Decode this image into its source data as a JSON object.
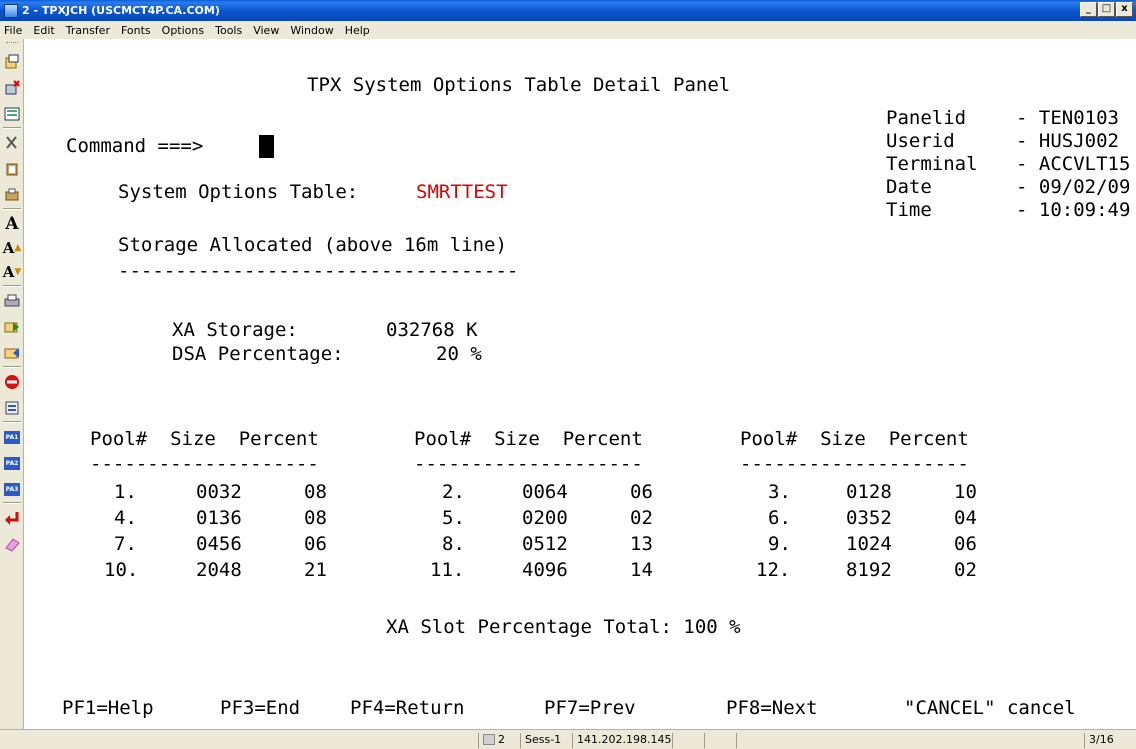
{
  "window": {
    "title": "2 - TPXJCH (USCMCT4P.CA.COM)",
    "min": "_",
    "max": "□",
    "close": "x"
  },
  "menu": [
    "File",
    "Edit",
    "Transfer",
    "Fonts",
    "Options",
    "Tools",
    "View",
    "Window",
    "Help"
  ],
  "toolbar": {
    "icons": [
      "copy-icon",
      "paste-icon",
      "select-icon",
      "cut-icon",
      "clipboard-icon",
      "print-screen-icon",
      "font-a-icon",
      "font-increase-icon",
      "font-decrease-icon",
      "print-icon",
      "send-icon",
      "receive-icon",
      "stop-icon",
      "properties-icon",
      "pa1-icon",
      "pa2-icon",
      "pa3-icon",
      "enter-icon",
      "eraser-icon"
    ],
    "labels": {
      "font_a": "A",
      "font_up": "A",
      "font_down": "A",
      "pa1": "PA1",
      "pa2": "PA2",
      "pa3": "PA3"
    }
  },
  "screen": {
    "header": "TPX System Options Table Detail Panel",
    "command_label": "Command ===>",
    "info": [
      {
        "label": "Panelid",
        "value": "- TEN0103"
      },
      {
        "label": "Userid",
        "value": "- HUSJ002"
      },
      {
        "label": "Terminal",
        "value": "- ACCVLT15"
      },
      {
        "label": "Date",
        "value": "- 09/02/09"
      },
      {
        "label": "Time",
        "value": "- 10:09:49"
      }
    ],
    "table_label": "System Options Table:",
    "table_name": "SMRTTEST",
    "storage_label": "Storage Allocated (above 16m line)",
    "storage_rule": "-----------------------------------",
    "xa_storage_label": "XA Storage:",
    "xa_storage_value": "032768 K",
    "dsa_label": "DSA Percentage:",
    "dsa_value": "20 %",
    "pool_header": "Pool#  Size  Percent",
    "pool_rule": "--------------------",
    "pools": [
      [
        "1.",
        "0032",
        "08"
      ],
      [
        "2.",
        "0064",
        "06"
      ],
      [
        "3.",
        "0128",
        "10"
      ],
      [
        "4.",
        "0136",
        "08"
      ],
      [
        "5.",
        "0200",
        "02"
      ],
      [
        "6.",
        "0352",
        "04"
      ],
      [
        "7.",
        "0456",
        "06"
      ],
      [
        "8.",
        "0512",
        "13"
      ],
      [
        "9.",
        "1024",
        "06"
      ],
      [
        "10.",
        "2048",
        "21"
      ],
      [
        "11.",
        "4096",
        "14"
      ],
      [
        "12.",
        "8192",
        "02"
      ]
    ],
    "slot_total": "XA Slot Percentage Total: 100 %",
    "pf_keys": [
      "PF1=Help",
      "PF3=End",
      "PF4=Return",
      "PF7=Prev",
      "PF8=Next",
      "\"CANCEL\" cancel"
    ]
  },
  "status": {
    "session_num": "2",
    "session": "Sess-1",
    "ip": "141.202.198.145",
    "cursor_pos": "3/16"
  }
}
